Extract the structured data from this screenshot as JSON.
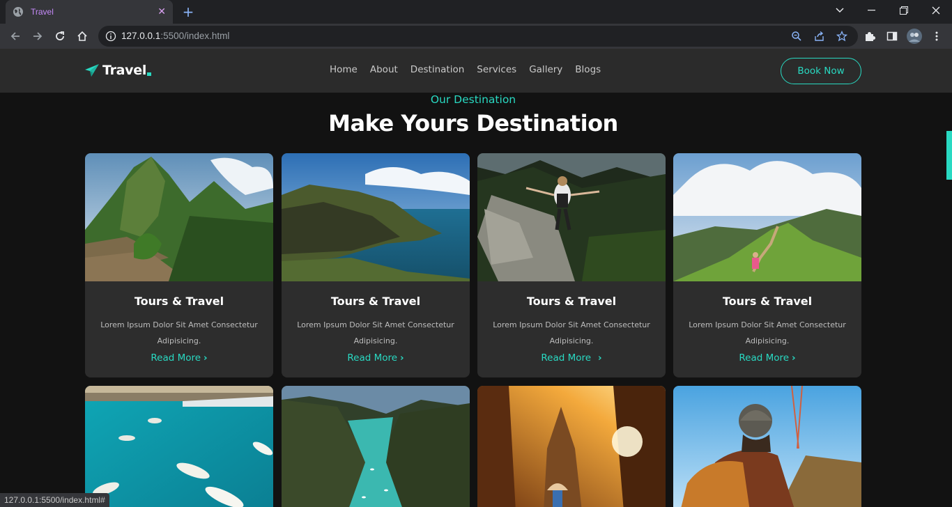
{
  "browser": {
    "tab_title": "Travel",
    "tab_close": "✕",
    "new_tab": "+",
    "url_host": "127.0.0.1",
    "url_rest": ":5500/index.html",
    "status_url": "127.0.0.1:5500/index.html#"
  },
  "site": {
    "logo": "Travel",
    "nav": [
      "Home",
      "About",
      "Destination",
      "Services",
      "Gallery",
      "Blogs"
    ],
    "book_label": "Book Now",
    "subtitle": "Our Destination",
    "heading": "Make Yours Destination",
    "accent": "#29d9c2"
  },
  "cards": [
    {
      "title": "Tours & Travel",
      "desc": "Lorem Ipsum Dolor Sit Amet Consectetur Adipisicing.",
      "link": "Read More",
      "image": "mountain-ruins"
    },
    {
      "title": "Tours & Travel",
      "desc": "Lorem Ipsum Dolor Sit Amet Consectetur Adipisicing.",
      "link": "Read More",
      "image": "sea-cliff"
    },
    {
      "title": "Tours & Travel",
      "desc": "Lorem Ipsum Dolor Sit Amet Consectetur Adipisicing.",
      "link": "Read More",
      "image": "hiker-trail"
    },
    {
      "title": "Tours & Travel",
      "desc": "Lorem Ipsum Dolor Sit Amet Consectetur Adipisicing.",
      "link": "Read More",
      "image": "green-ridge"
    }
  ],
  "cards_row2": [
    {
      "image": "harbor-boats"
    },
    {
      "image": "river-canyon"
    },
    {
      "image": "temple-sunset"
    },
    {
      "image": "backpacker"
    }
  ]
}
